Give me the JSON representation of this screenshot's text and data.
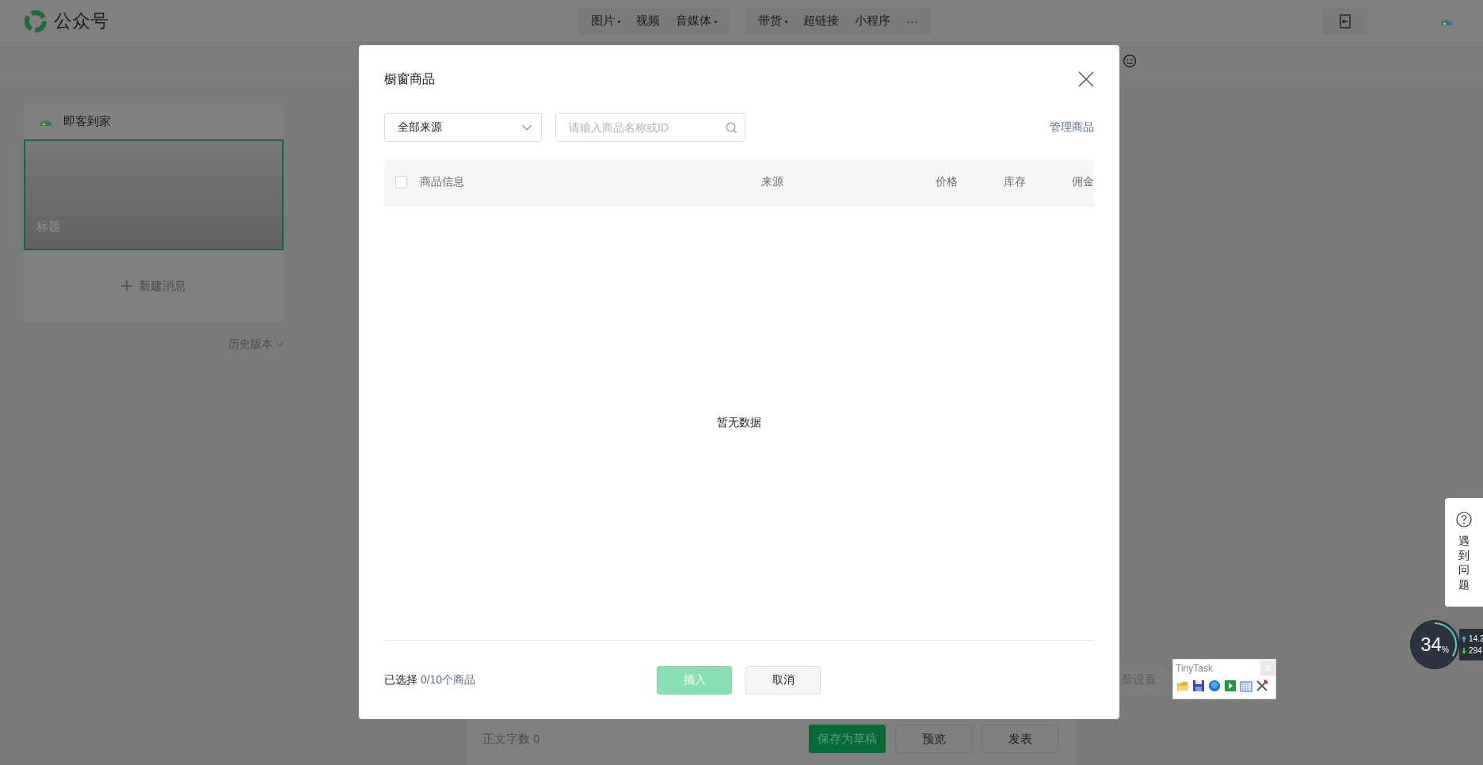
{
  "top_bar": {
    "logo_text": "公众号",
    "toolbar_groups": [
      [
        {
          "label": "图片",
          "has_menu": true
        },
        {
          "label": "视频",
          "has_menu": false
        },
        {
          "label": "音媒体",
          "has_menu": true
        }
      ],
      [
        {
          "label": "带货",
          "has_menu": true
        },
        {
          "label": "超链接",
          "has_menu": false
        },
        {
          "label": "小程序",
          "has_menu": false
        },
        {
          "label": "···",
          "has_menu": false
        }
      ]
    ]
  },
  "sidebar": {
    "account_name": "即客到家",
    "articles": [
      {
        "title": "标题",
        "selected": true
      }
    ],
    "new_message": "新建消息",
    "history": "历史版本"
  },
  "dialog": {
    "title": "橱窗商品",
    "source_select": "全部来源",
    "search": {
      "placeholder": "请输入商品名称或ID"
    },
    "manage_link": "管理商品",
    "table": {
      "select_all": false,
      "columns": [
        "商品信息",
        "来源",
        "价格",
        "库存",
        "佣金"
      ],
      "empty_text": "暂无数据"
    },
    "selection": {
      "label": "已选择",
      "count": "0/10个商品"
    },
    "buttons": [
      {
        "label": "插入",
        "kind": "primary",
        "disabled": true
      },
      {
        "label": "取消",
        "kind": "default",
        "disabled": false
      }
    ]
  },
  "editor_footer": {
    "word_count_label": "正文字数",
    "word_count": "0",
    "buttons": [
      {
        "label": "保存为草稿",
        "kind": "primary"
      },
      {
        "label": "预览",
        "kind": "default"
      },
      {
        "label": "发表",
        "kind": "default"
      }
    ],
    "settings_button": "章设置"
  },
  "help_widget": {
    "label": "遇到问题"
  },
  "speed_meter": {
    "percent": "34",
    "unit": "%",
    "upload": "14.2",
    "download": "294"
  },
  "tinytask": {
    "title": "TinyTask"
  }
}
